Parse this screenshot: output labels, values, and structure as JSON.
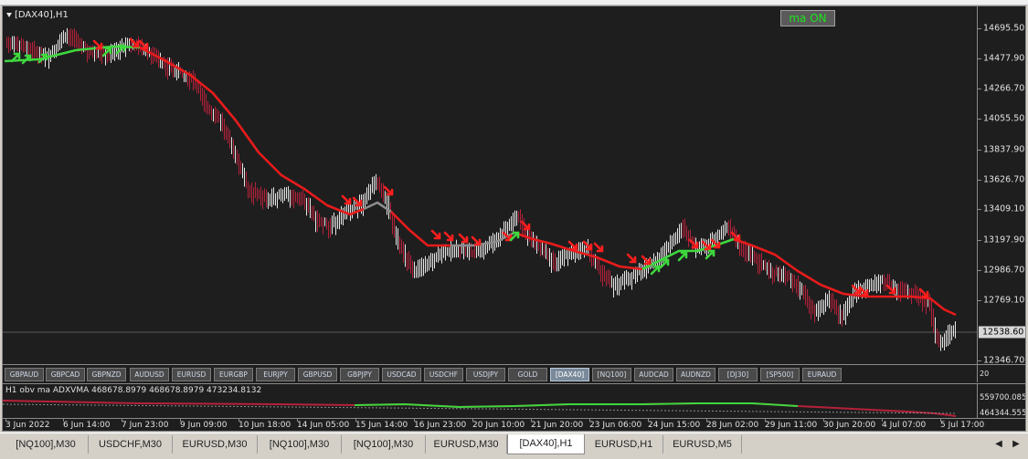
{
  "chart": {
    "title": "[DAX40],H1",
    "ma_button": "ma ON",
    "current_price": "12538.60",
    "price_ticks": [
      "14695.50",
      "14477.90",
      "14266.70",
      "14055.50",
      "13837.90",
      "13626.70",
      "13409.10",
      "13197.90",
      "12986.70",
      "12769.10",
      "12538.60",
      "12346.70"
    ],
    "time_labels": [
      "3 Jun 2022",
      "6 Jun 14:00",
      "7 Jun 23:00",
      "9 Jun 09:00",
      "10 Jun 18:00",
      "14 Jun 05:00",
      "15 Jun 14:00",
      "16 Jun 23:00",
      "20 Jun 10:00",
      "21 Jun 20:00",
      "23 Jun 06:00",
      "24 Jun 15:00",
      "28 Jun 02:00",
      "29 Jun 11:00",
      "30 Jun 20:00",
      "4 Jul 07:00",
      "5 Jul 17:00"
    ]
  },
  "symbols": [
    "GBPAUD",
    "GBPCAD",
    "GBPNZD",
    "AUDUSD",
    "EURUSD",
    "EURGBP",
    "EURJPY",
    "GBPUSD",
    "GBPJPY",
    "USDCAD",
    "USDCHF",
    "USDJPY",
    "GOLD",
    "[DAX40]",
    "[NQ100]",
    "AUDCAD",
    "AUDNZD",
    "[DJ30]",
    "[SP500]",
    "EURAUD"
  ],
  "active_symbol": "[DAX40]",
  "sub_window": {
    "label": "H1 obv ma  ADXVMA  468678.8979 468678.8979 473234.8132",
    "axis_top": "20",
    "ticks": [
      "559700.085",
      "464344.555"
    ]
  },
  "tabs": [
    "[NQ100],M30",
    "USDCHF,M30",
    "EURUSD,M30",
    "[NQ100],M30",
    "[NQ100],M30",
    "EURUSD,M30",
    "[DAX40],H1",
    "EURUSD,H1",
    "EURUSD,M5"
  ],
  "active_tab_index": 6,
  "colors": {
    "background": "#1e1e1e",
    "bull_candle": "#e6e6e6",
    "bear_candle": "#b4213a",
    "ma_down": "#e81b1b",
    "ma_up": "#3ed83e",
    "ma_flat": "#8c8c8c",
    "ma_on_text": "#19e619"
  }
}
